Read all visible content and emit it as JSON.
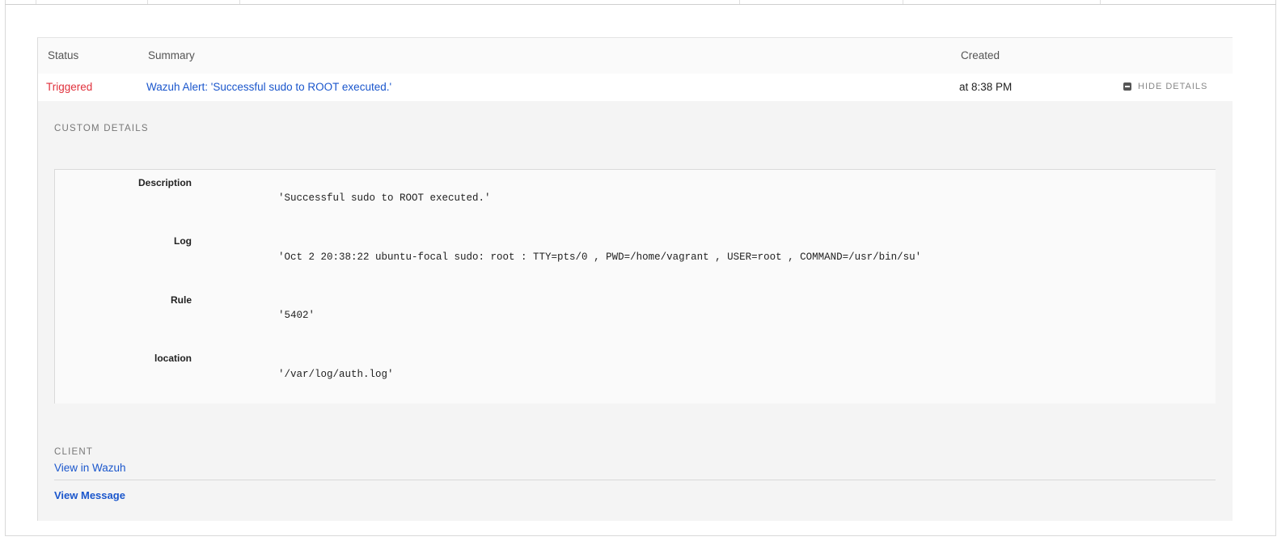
{
  "table": {
    "headers": {
      "status": "Status",
      "summary": "Summary",
      "created": "Created"
    },
    "alert": {
      "status": "Triggered",
      "summary": "Wazuh Alert: 'Successful sudo to ROOT executed.'",
      "created": "at 8:38 PM",
      "toggle_label": "HIDE DETAILS"
    }
  },
  "custom_details": {
    "title": "CUSTOM DETAILS",
    "items": [
      {
        "key": "Description",
        "value": "'Successful sudo to ROOT executed.'"
      },
      {
        "key": "Log",
        "value": "'Oct 2 20:38:22 ubuntu-focal sudo: root : TTY=pts/0 , PWD=/home/vagrant , USER=root , COMMAND=/usr/bin/su'"
      },
      {
        "key": "Rule",
        "value": "'5402'"
      },
      {
        "key": "location",
        "value": "'/var/log/auth.log'"
      }
    ]
  },
  "client": {
    "title": "CLIENT",
    "link_label": "View in Wazuh"
  },
  "view_message_label": "View Message",
  "colors": {
    "triggered": "#e0313c",
    "link": "#1a56cc"
  }
}
